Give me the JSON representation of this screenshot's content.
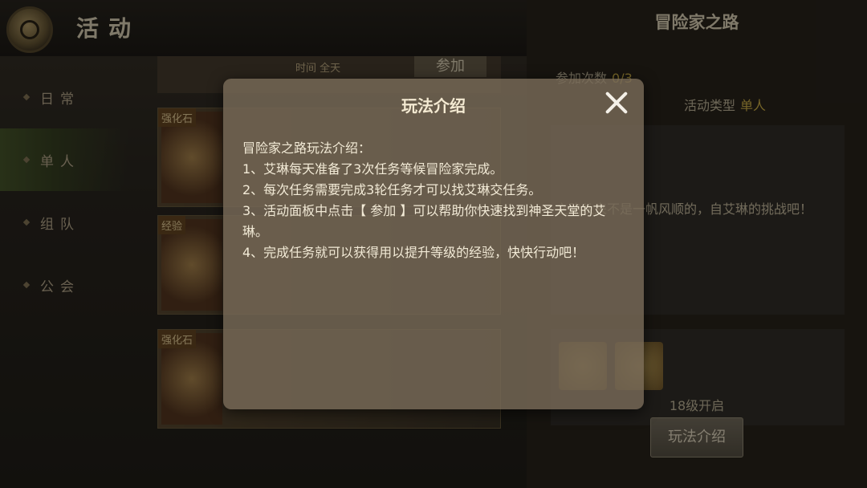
{
  "header": {
    "title": "活动"
  },
  "tabs": [
    {
      "label": "日常",
      "active": false
    },
    {
      "label": "单人",
      "active": true
    },
    {
      "label": "组队",
      "active": false
    },
    {
      "label": "公会",
      "active": false
    }
  ],
  "list": {
    "top_row": {
      "time_label": "时间",
      "time_value": "全天",
      "join_label": "参加"
    },
    "rows": [
      {
        "badge": "强化石"
      },
      {
        "badge": "经验"
      },
      {
        "badge": "强化石"
      }
    ]
  },
  "right_panel": {
    "title": "冒险家之路",
    "participation_label": "参加次数",
    "participation_value": "0/3",
    "activity_type_label": "活动类型",
    "activity_type_value": "单人",
    "desc": "之路从来不是一帆风顺的，自艾琳的挑战吧！",
    "level_requirement": "18级开启",
    "intro_button": "玩法介绍"
  },
  "modal": {
    "title": "玩法介绍",
    "lines": [
      "冒险家之路玩法介绍：",
      "1、艾琳每天准备了3次任务等候冒险家完成。",
      "2、每次任务需要完成3轮任务才可以找艾琳交任务。",
      "3、活动面板中点击【 参加 】可以帮助你快速找到神圣天堂的艾琳。",
      "4、完成任务就可以获得用以提升等级的经验，快快行动吧！"
    ]
  },
  "colors": {
    "accent": "#d8b84a",
    "text": "#f2ead6"
  }
}
